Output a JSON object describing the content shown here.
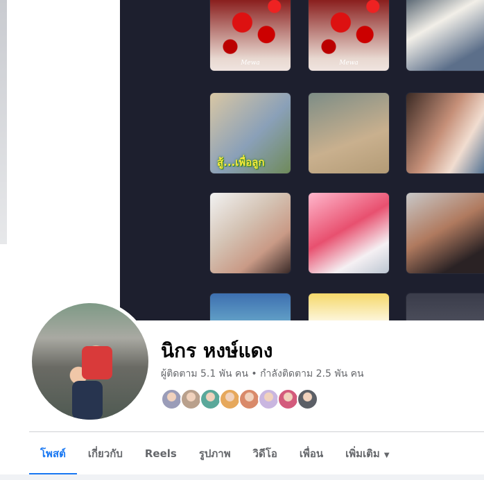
{
  "profile": {
    "name": "นิกร หงษ์แดง",
    "stats": "ผู้ติดตาม 5.1 พัน คน • กำลังติดตาม 2.5 พัน คน"
  },
  "cover": {
    "tiles": [
      {
        "caption": "Mewa"
      },
      {
        "caption": "Mewa"
      },
      {
        "caption": ""
      },
      {
        "caption": "สู้...เพื่อลูก"
      },
      {
        "caption": ""
      },
      {
        "caption": ""
      },
      {
        "caption": ""
      },
      {
        "caption": ""
      },
      {
        "caption": ""
      },
      {
        "caption": ""
      },
      {
        "caption": ""
      },
      {
        "caption": ""
      }
    ]
  },
  "friends": {
    "avatar_icons": [
      "friend-avatar",
      "friend-avatar",
      "friend-avatar",
      "friend-avatar",
      "friend-avatar",
      "friend-avatar",
      "friend-avatar",
      "friend-avatar"
    ],
    "colors": [
      "#9a9cb8",
      "#b9a08c",
      "#5aa89a",
      "#e6a85c",
      "#d98a6a",
      "#c9b6e0",
      "#d35b7c",
      "#5b5f66"
    ]
  },
  "tabs": {
    "posts": "โพสต์",
    "about": "เกี่ยวกับ",
    "reels": "Reels",
    "photos": "รูปภาพ",
    "videos": "วิดีโอ",
    "friends": "เพื่อน",
    "more": "เพิ่มเติม",
    "more_icon": "▼"
  },
  "theme": {
    "accent": "#1877f2",
    "text_primary": "#050505",
    "text_secondary": "#65676b"
  }
}
